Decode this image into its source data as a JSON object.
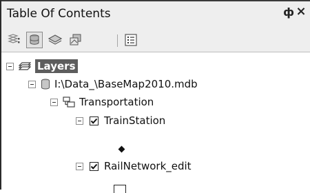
{
  "window": {
    "title": "Table Of Contents",
    "pin_glyph": "ф",
    "close_glyph": "×"
  },
  "toolbar": {
    "buttons": [
      {
        "icon": "list-by-drawing-order-icon",
        "selected": false
      },
      {
        "icon": "list-by-source-icon",
        "selected": true
      },
      {
        "icon": "list-by-visibility-icon",
        "selected": false
      },
      {
        "icon": "list-by-selection-icon",
        "selected": false
      },
      {
        "icon": "options-icon",
        "selected": false
      }
    ]
  },
  "tree": {
    "layers_label": "Layers",
    "source_label": "I:\\Data_\\BaseMap2010.mdb",
    "group_label": "Transportation",
    "layer1_label": "TrainStation",
    "layer1_checked": true,
    "layer2_label": "RailNetwork_edit",
    "layer2_checked": true
  }
}
